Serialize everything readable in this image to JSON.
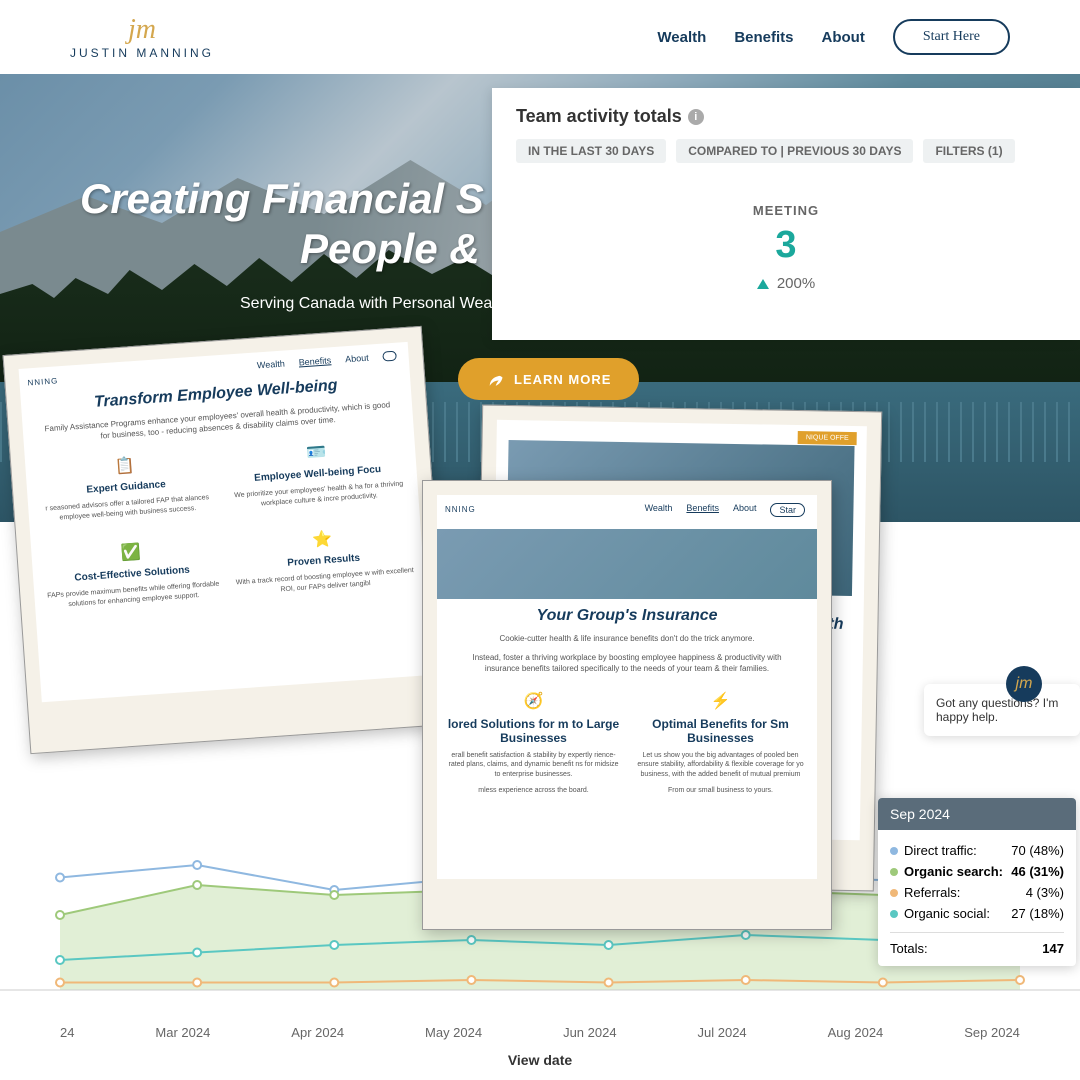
{
  "header": {
    "logo_text": "JUSTIN MANNING",
    "nav": {
      "wealth": "Wealth",
      "benefits": "Benefits",
      "about": "About"
    },
    "cta": "Start Here"
  },
  "hero": {
    "line1": "Creating Financial S",
    "line2": "People & ",
    "sub": "Serving Canada with Personal Wea",
    "learn": "LEARN MORE"
  },
  "panel": {
    "title": "Team activity totals",
    "pills": {
      "p1": "IN THE LAST 30 DAYS",
      "p2": "COMPARED TO | PREVIOUS 30 DAYS",
      "p3": "FILTERS (1)"
    },
    "metric_label": "MEETING",
    "metric_value": "3",
    "metric_change": "200%"
  },
  "poly1": {
    "nav": {
      "a": "Wealth",
      "b": "Benefits",
      "c": "About"
    },
    "logo": "NNING",
    "title": "Transform Employee Well-being",
    "desc": "Family Assistance Programs enhance your employees' overall health & productivity, which is good for business, too - reducing absences & disability claims over time.",
    "c1_t": "Expert Guidance",
    "c1_d": "r seasoned advisors offer a tailored FAP that alances employee well-being with business success.",
    "c2_t": "Employee Well-being Focu",
    "c2_d": "We prioritize your employees' health & ha for a thriving workplace culture & incre productivity.",
    "c3_t": "Cost-Effective Solutions",
    "c3_d": "FAPs provide maximum benefits while offering ffordable solutions for enhancing employee support.",
    "c4_t": "Proven Results",
    "c4_d": "With a track record of boosting employee w with excellent ROI, our FAPs deliver tangibl"
  },
  "poly3": {
    "nav": {
      "a": "Wealth",
      "b": "Benefits",
      "c": "About",
      "d": "Star"
    },
    "logo": "NNING",
    "title_a": "Your Group's",
    "title_b": " Insurance",
    "desc1": "Cookie-cutter health & life insurance benefits don't do the trick anymore.",
    "desc2": "Instead, foster a thriving workplace by boosting employee happiness & productivity with insurance benefits tailored specifically to the needs of your team & their families.",
    "c1_t": "lored Solutions for m to Large Businesses",
    "c1_d": "erall benefit satisfaction & stability by expertly rience-rated plans, claims, and dynamic benefit ns for midsize to enterprise businesses.",
    "c1_d2": "mless experience across the board.",
    "c2_t": "Optimal Benefits for Sm Businesses",
    "c2_d": "Let us show you the big advantages of pooled ben ensure stability, affordability & flexible coverage for yo business, with the added benefit of mutual premium",
    "c2_d2": "From our small business to yours."
  },
  "chart_data": {
    "type": "line",
    "x": [
      "24",
      "Mar 2024",
      "Apr 2024",
      "May 2024",
      "Jun 2024",
      "Jul 2024",
      "Aug 2024",
      "Sep 2024"
    ],
    "xlabel": "View date",
    "series": [
      {
        "name": "Direct traffic",
        "color": "#8fb8e0",
        "values": [
          45,
          50,
          40,
          45,
          42,
          45,
          44,
          70
        ]
      },
      {
        "name": "Organic search",
        "color": "#9ec97a",
        "values": [
          30,
          42,
          38,
          40,
          38,
          40,
          38,
          46
        ]
      },
      {
        "name": "Referrals",
        "color": "#f0b878",
        "values": [
          3,
          3,
          3,
          4,
          3,
          4,
          3,
          4
        ]
      },
      {
        "name": "Organic social",
        "color": "#5ac7c2",
        "values": [
          12,
          15,
          18,
          20,
          18,
          22,
          20,
          27
        ]
      }
    ]
  },
  "tooltip": {
    "title": "Sep 2024",
    "rows": [
      {
        "label": "Direct traffic:",
        "value": "70 (48%)",
        "color": "#8fb8e0",
        "bold": false
      },
      {
        "label": "Organic search:",
        "value": "46 (31%)",
        "color": "#9ec97a",
        "bold": true
      },
      {
        "label": "Referrals:",
        "value": "4 (3%)",
        "color": "#f0b878",
        "bold": false
      },
      {
        "label": "Organic social:",
        "value": "27 (18%)",
        "color": "#5ac7c2",
        "bold": false
      }
    ],
    "total_label": "Totals:",
    "total_value": "147"
  },
  "chat": {
    "text": "Got any questions? I'm happy help."
  },
  "poly2_badge": "NIQUE OFFE",
  "poly2_title": "alth"
}
